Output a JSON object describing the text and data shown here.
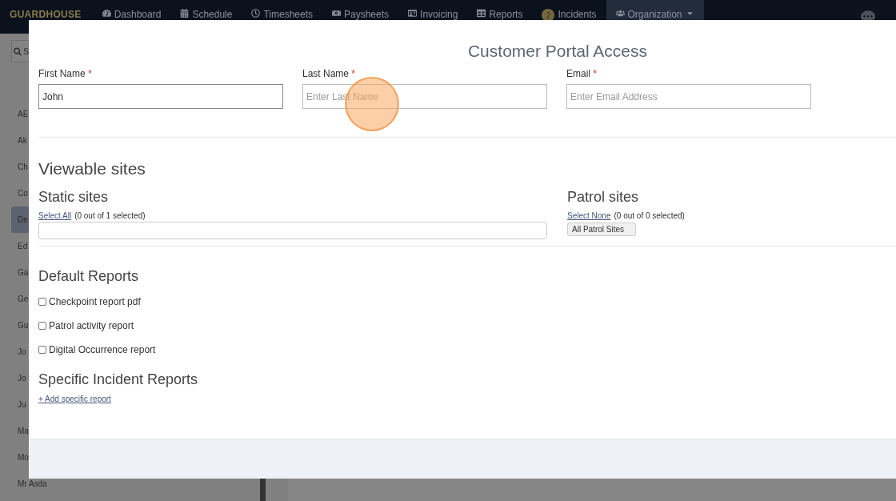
{
  "nav": {
    "brand": "GUARDHOUSE",
    "items": [
      {
        "label": "Dashboard",
        "selected": false
      },
      {
        "label": "Schedule",
        "selected": false
      },
      {
        "label": "Timesheets",
        "selected": false
      },
      {
        "label": "Paysheets",
        "selected": false
      },
      {
        "label": "Invoicing",
        "selected": false
      },
      {
        "label": "Reports",
        "selected": false
      },
      {
        "label": "Incidents",
        "badge": "2",
        "selected": false
      },
      {
        "label": "Organization",
        "dropdown": true,
        "selected": true
      }
    ]
  },
  "sidebar": {
    "search": {
      "placeholder": "S"
    },
    "items": [
      {
        "label": "AE",
        "selected": false
      },
      {
        "label": "Ak",
        "selected": false
      },
      {
        "label": "Ch",
        "selected": false
      },
      {
        "label": "Co",
        "selected": false
      },
      {
        "label": "De",
        "selected": true
      },
      {
        "label": "Ed",
        "selected": false
      },
      {
        "label": "Ga",
        "selected": false
      },
      {
        "label": "Ge",
        "selected": false
      },
      {
        "label": "Gu",
        "selected": false
      },
      {
        "label": "Jo",
        "selected": false
      },
      {
        "label": "Jo",
        "selected": false
      },
      {
        "label": "Ju",
        "selected": false
      },
      {
        "label": "Ma",
        "selected": false
      },
      {
        "label": "Mo",
        "selected": false
      },
      {
        "label": "Mr Asda",
        "selected": false
      }
    ]
  },
  "modal": {
    "title": "Customer Portal Access",
    "fields": [
      {
        "label": "First Name",
        "required_mark": "*",
        "value": "John",
        "focused": true
      },
      {
        "label": "Last Name",
        "required_mark": "*",
        "placeholder": "Enter Last Name",
        "focused": false
      },
      {
        "label": "Email",
        "required_mark": "*",
        "placeholder": "Enter Email Address",
        "focused": false
      }
    ],
    "viewable_title": "Viewable sites",
    "static_sites": {
      "title": "Static sites",
      "link": "Select All",
      "count": "(0 out of 1 selected)"
    },
    "patrol_sites": {
      "title": "Patrol sites",
      "link": "Select None",
      "count": "(0 out of 0 selected)",
      "button": "All Patrol Sites"
    },
    "default_reports": {
      "title": "Default Reports",
      "items": [
        {
          "label": "Checkpoint report pdf",
          "checked": false
        },
        {
          "label": "Patrol activity report",
          "checked": false
        },
        {
          "label": "Digital Occurrence report",
          "checked": false
        }
      ]
    },
    "specific_reports": {
      "title": "Specific Incident Reports",
      "link": "+ Add specific report"
    }
  }
}
